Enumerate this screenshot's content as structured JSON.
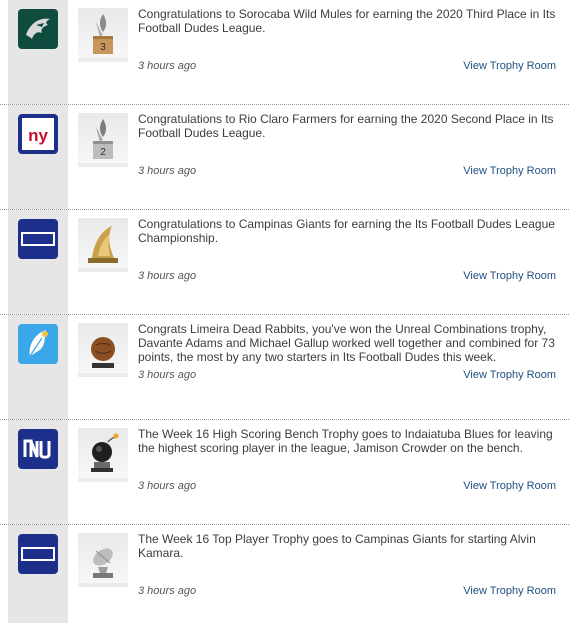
{
  "link_label": "View Trophy Room",
  "entries": [
    {
      "team_logo_icon": "eagles-logo-icon",
      "trophy_icon": "third-place-trophy-icon",
      "message": "Congratulations to Sorocaba Wild Mules for earning the 2020 Third Place in Its Football Dudes League.",
      "time": "3 hours ago",
      "link": "View Trophy Room"
    },
    {
      "team_logo_icon": "ny-giants-logo-icon",
      "trophy_icon": "second-place-trophy-icon",
      "message": "Congratulations to Rio Claro Farmers for earning the 2020 Second Place in Its Football Dudes League.",
      "time": "3 hours ago",
      "link": "View Trophy Room"
    },
    {
      "team_logo_icon": "giants-wordmark-logo-icon",
      "trophy_icon": "championship-trophy-icon",
      "message": "Congratulations to Campinas Giants for earning the Its Football Dudes League Championship.",
      "time": "3 hours ago",
      "link": "View Trophy Room"
    },
    {
      "team_logo_icon": "feather-logo-icon",
      "trophy_icon": "football-trophy-icon",
      "message": "Congrats Limeira Dead Rabbits, you've won the Unreal Combinations trophy, Davante Adams and Michael Gallup worked well together and combined for 73 points, the most by any two starters in Its Football Dudes this week.",
      "time": "3 hours ago",
      "link": "View Trophy Room"
    },
    {
      "team_logo_icon": "nyj-style-logo-icon",
      "trophy_icon": "bomb-trophy-icon",
      "message": "The Week 16 High Scoring Bench Trophy goes to Indaiatuba Blues for leaving the highest scoring player in the league, Jamison Crowder on the bench.",
      "time": "3 hours ago",
      "link": "View Trophy Room"
    },
    {
      "team_logo_icon": "giants-wordmark-logo-icon",
      "trophy_icon": "top-player-trophy-icon",
      "message": "The Week 16 Top Player Trophy goes to Campinas Giants for starting Alvin Kamara.",
      "time": "3 hours ago",
      "link": "View Trophy Room"
    }
  ]
}
